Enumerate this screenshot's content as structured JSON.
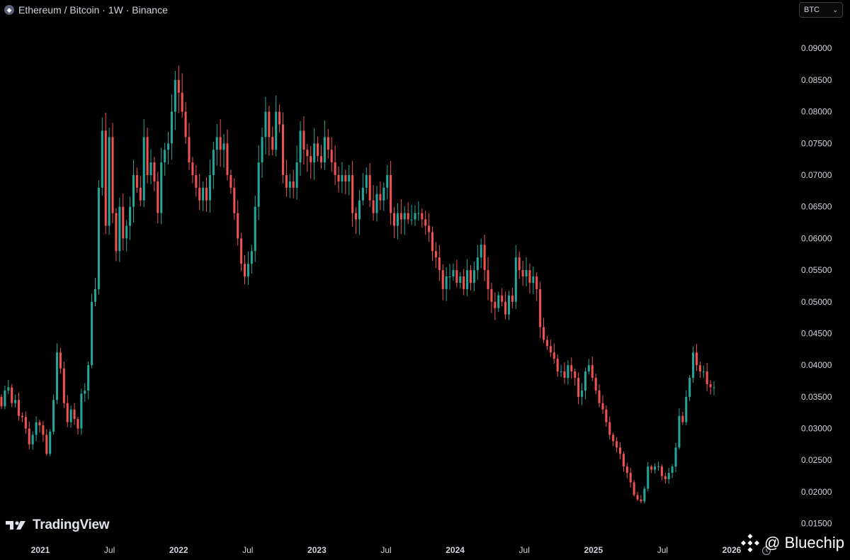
{
  "header": {
    "symbol_icon": "ethereum-icon",
    "title": "Ethereum / Bitcoin · 1W · Binance",
    "currency_select": "BTC"
  },
  "footer": {
    "brand": "TradingView",
    "brand_icon": "tradingview-logo-icon",
    "watermark": "@ Bluechip",
    "watermark_icon": "binance-square-icon"
  },
  "chart_data": {
    "type": "candlestick",
    "timeframe": "1W",
    "pair": "ETH/BTC",
    "y_unit": "BTC",
    "ylim": [
      0.0135,
      0.0945
    ],
    "y_ticks": [
      "0.09000",
      "0.08500",
      "0.08000",
      "0.07500",
      "0.07000",
      "0.06500",
      "0.06000",
      "0.05500",
      "0.05000",
      "0.04500",
      "0.04000",
      "0.03500",
      "0.03000",
      "0.02500",
      "0.02000",
      "0.01500"
    ],
    "x_ticks": [
      {
        "label": "2021",
        "bold": true
      },
      {
        "label": "Jul",
        "bold": false
      },
      {
        "label": "2022",
        "bold": true
      },
      {
        "label": "Jul",
        "bold": false
      },
      {
        "label": "2023",
        "bold": true
      },
      {
        "label": "Jul",
        "bold": false
      },
      {
        "label": "2024",
        "bold": true
      },
      {
        "label": "Jul",
        "bold": false
      },
      {
        "label": "2025",
        "bold": true
      },
      {
        "label": "Jul",
        "bold": false
      },
      {
        "label": "2026",
        "bold": true
      }
    ],
    "colors": {
      "up": "#26a69a",
      "down": "#ef5350",
      "background": "#000000",
      "text": "#d1d4dc"
    },
    "weekly_closes": [
      0.0335,
      0.036,
      0.0365,
      0.034,
      0.0345,
      0.032,
      0.0318,
      0.03,
      0.0275,
      0.029,
      0.031,
      0.0305,
      0.029,
      0.026,
      0.0295,
      0.0345,
      0.042,
      0.0395,
      0.034,
      0.031,
      0.033,
      0.0315,
      0.03,
      0.0355,
      0.036,
      0.04,
      0.05,
      0.052,
      0.068,
      0.077,
      0.062,
      0.076,
      0.064,
      0.058,
      0.065,
      0.06,
      0.062,
      0.065,
      0.07,
      0.068,
      0.066,
      0.076,
      0.07,
      0.072,
      0.069,
      0.064,
      0.072,
      0.074,
      0.075,
      0.08,
      0.085,
      0.083,
      0.08,
      0.076,
      0.072,
      0.07,
      0.068,
      0.066,
      0.068,
      0.066,
      0.07,
      0.074,
      0.076,
      0.074,
      0.075,
      0.07,
      0.068,
      0.064,
      0.06,
      0.056,
      0.054,
      0.056,
      0.058,
      0.065,
      0.072,
      0.076,
      0.08,
      0.076,
      0.074,
      0.08,
      0.078,
      0.07,
      0.068,
      0.069,
      0.068,
      0.072,
      0.077,
      0.074,
      0.073,
      0.072,
      0.075,
      0.073,
      0.072,
      0.076,
      0.074,
      0.072,
      0.07,
      0.069,
      0.07,
      0.069,
      0.07,
      0.064,
      0.063,
      0.066,
      0.068,
      0.07,
      0.066,
      0.064,
      0.067,
      0.066,
      0.068,
      0.07,
      0.064,
      0.062,
      0.064,
      0.063,
      0.064,
      0.063,
      0.063,
      0.064,
      0.064,
      0.063,
      0.062,
      0.061,
      0.058,
      0.057,
      0.055,
      0.052,
      0.054,
      0.054,
      0.055,
      0.053,
      0.054,
      0.052,
      0.055,
      0.053,
      0.055,
      0.057,
      0.059,
      0.055,
      0.052,
      0.05,
      0.049,
      0.051,
      0.05,
      0.048,
      0.051,
      0.05,
      0.057,
      0.055,
      0.054,
      0.055,
      0.053,
      0.054,
      0.052,
      0.046,
      0.044,
      0.043,
      0.042,
      0.041,
      0.039,
      0.039,
      0.038,
      0.04,
      0.039,
      0.038,
      0.035,
      0.036,
      0.039,
      0.04,
      0.038,
      0.036,
      0.034,
      0.033,
      0.031,
      0.029,
      0.028,
      0.027,
      0.026,
      0.024,
      0.023,
      0.0215,
      0.0195,
      0.0188,
      0.0185,
      0.0205,
      0.024,
      0.0235,
      0.024,
      0.024,
      0.0225,
      0.022,
      0.023,
      0.024,
      0.027,
      0.032,
      0.031,
      0.035,
      0.038,
      0.042,
      0.04,
      0.039,
      0.039,
      0.037,
      0.0365,
      0.0365
    ]
  }
}
